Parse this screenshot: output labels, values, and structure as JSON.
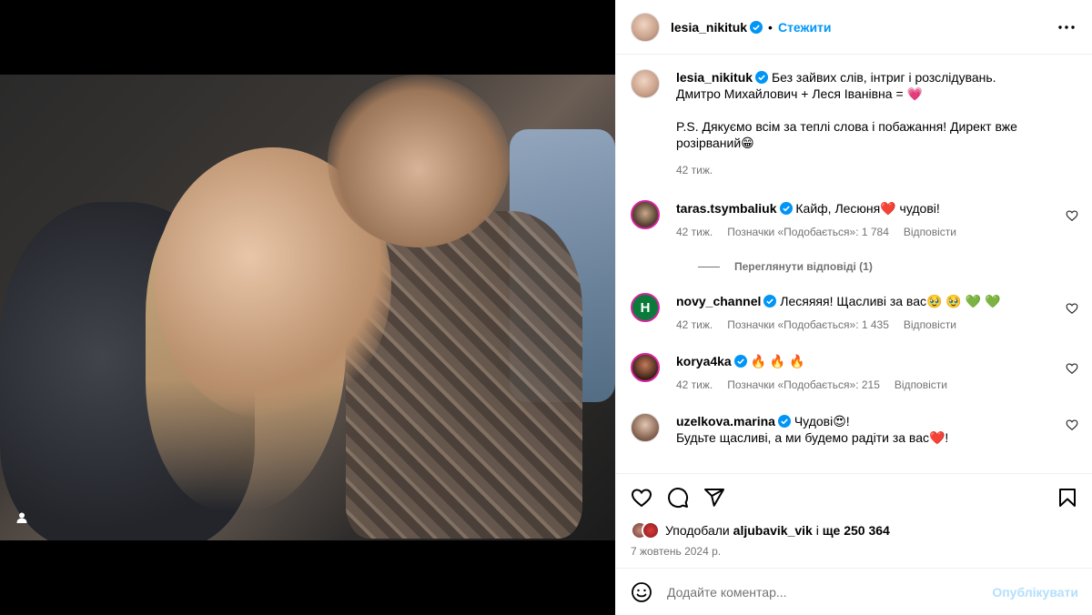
{
  "post": {
    "author": "lesia_nikituk",
    "follow_label": "Стежити",
    "dot": "•"
  },
  "caption": {
    "username": "lesia_nikituk",
    "text_line1": "Без зайвих слів, інтриг і розслідувань.",
    "text_line2": "Дмитро Михайлович + Леся Іванівна = 💗",
    "text_line3": "P.S. Дякуємо всім за теплі слова і побажання! Директ вже розірваний😁",
    "time": "42 тиж."
  },
  "comments": [
    {
      "username": "taras.tsymbaliuk",
      "text": "Кайф, Лесюня❤️  чудові!",
      "time": "42 тиж.",
      "likes": "Позначки «Подобається»: 1 784",
      "reply": "Відповісти"
    },
    {
      "username": "novy_channel",
      "avatar_letter": "Н",
      "text": "Лесяяяя! Щасливі за вас🥹 🥹 💚 💚",
      "time": "42 тиж.",
      "likes": "Позначки «Подобається»: 1 435",
      "reply": "Відповісти"
    },
    {
      "username": "korya4ka",
      "text": "🔥 🔥 🔥",
      "time": "42 тиж.",
      "likes": "Позначки «Подобається»: 215",
      "reply": "Відповісти"
    },
    {
      "username": "uzelkova.marina",
      "text": "Чудові😍!",
      "text2": "Будьте щасливі, а ми будемо радіти за вас❤️!"
    }
  ],
  "view_replies": "Переглянути відповіді (1)",
  "likes": {
    "prefix": "Уподобали",
    "user": "aljubavik_vik",
    "middle": "і",
    "count": "ще 250 364"
  },
  "date": "7 жовтень 2024 р.",
  "add_comment": {
    "placeholder": "Додайте коментар...",
    "publish": "Опублікувати"
  },
  "colors": {
    "accent": "#0095f6",
    "publish_disabled": "#b2dffc",
    "muted": "#737373"
  }
}
